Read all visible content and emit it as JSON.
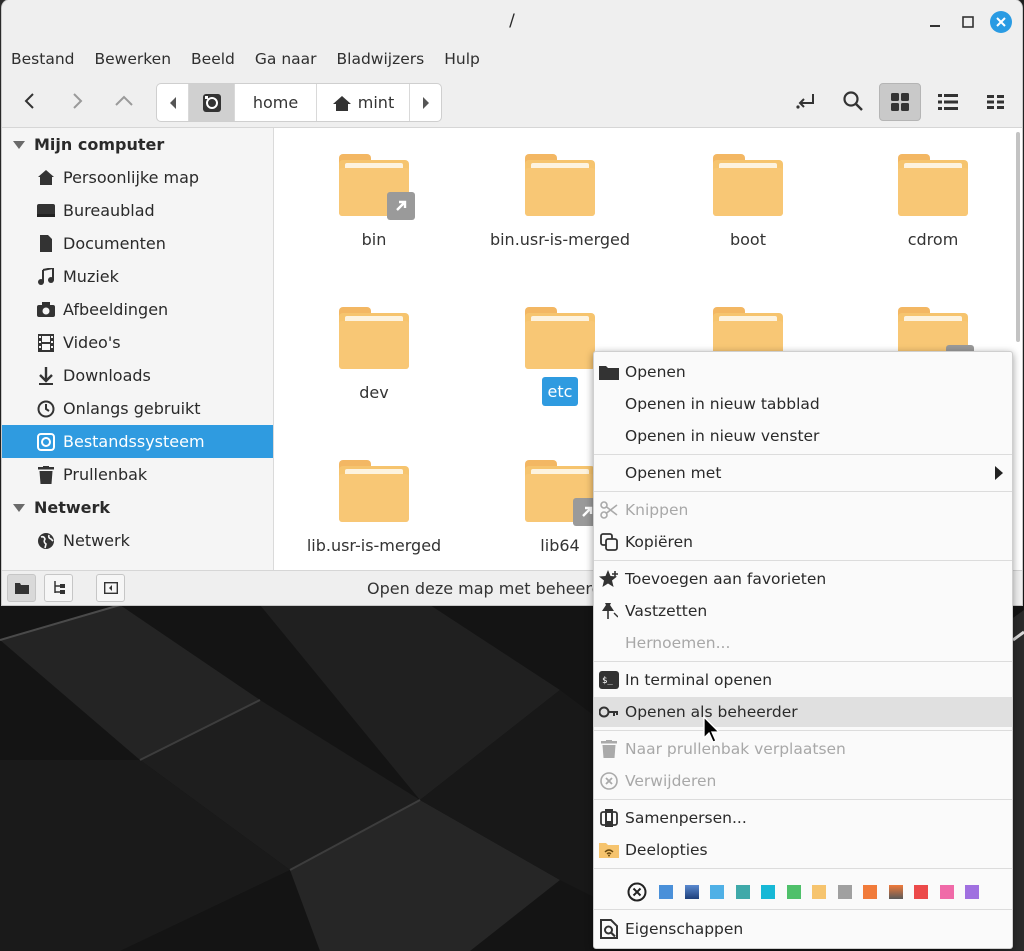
{
  "window": {
    "title": "/"
  },
  "menubar": [
    "Bestand",
    "Bewerken",
    "Beeld",
    "Ga naar",
    "Bladwijzers",
    "Hulp"
  ],
  "pathbar": {
    "segments": [
      "home",
      "mint"
    ]
  },
  "sidebar": {
    "sections": [
      {
        "title": "Mijn computer",
        "items": [
          {
            "label": "Persoonlijke map",
            "icon": "home-icon"
          },
          {
            "label": "Bureaublad",
            "icon": "desktop-icon"
          },
          {
            "label": "Documenten",
            "icon": "document-icon"
          },
          {
            "label": "Muziek",
            "icon": "music-icon"
          },
          {
            "label": "Afbeeldingen",
            "icon": "camera-icon"
          },
          {
            "label": "Video's",
            "icon": "film-icon"
          },
          {
            "label": "Downloads",
            "icon": "download-icon"
          },
          {
            "label": "Onlangs gebruikt",
            "icon": "clock-icon"
          },
          {
            "label": "Bestandssysteem",
            "icon": "drive-icon"
          },
          {
            "label": "Prullenbak",
            "icon": "trash-icon"
          }
        ]
      },
      {
        "title": "Netwerk",
        "items": [
          {
            "label": "Netwerk",
            "icon": "globe-icon"
          }
        ]
      }
    ],
    "selected": "Bestandssysteem"
  },
  "files": [
    {
      "name": "bin",
      "symlink": true
    },
    {
      "name": "bin.usr-is-merged",
      "symlink": false
    },
    {
      "name": "boot",
      "symlink": false
    },
    {
      "name": "cdrom",
      "symlink": false
    },
    {
      "name": "dev",
      "symlink": false
    },
    {
      "name": "etc",
      "symlink": false,
      "selected": true
    },
    {
      "name": "",
      "symlink": false
    },
    {
      "name": "",
      "symlink": true
    },
    {
      "name": "lib.usr-is-merged",
      "symlink": false
    },
    {
      "name": "lib64",
      "symlink": true
    }
  ],
  "status": {
    "text": "Open deze map met beheerder"
  },
  "context_menu": {
    "items": [
      {
        "label": "Openen",
        "icon": "folder-icon",
        "disabled": false
      },
      {
        "label": "Openen in nieuw tabblad",
        "icon": "",
        "disabled": false
      },
      {
        "label": "Openen in nieuw venster",
        "icon": "",
        "disabled": false
      },
      {
        "label": "Openen met",
        "icon": "",
        "disabled": false,
        "submenu": true
      },
      {
        "label": "Knippen",
        "icon": "scissors-icon",
        "disabled": true
      },
      {
        "label": "Kopiëren",
        "icon": "copy-icon",
        "disabled": false
      },
      {
        "label": "Toevoegen aan favorieten",
        "icon": "star-icon",
        "disabled": false
      },
      {
        "label": "Vastzetten",
        "icon": "pin-icon",
        "disabled": false
      },
      {
        "label": "Hernoemen...",
        "icon": "",
        "disabled": true
      },
      {
        "label": "In terminal openen",
        "icon": "terminal-icon",
        "disabled": false
      },
      {
        "label": "Openen als beheerder",
        "icon": "key-icon",
        "disabled": false,
        "hover": true
      },
      {
        "label": "Naar prullenbak verplaatsen",
        "icon": "trash-icon",
        "disabled": true
      },
      {
        "label": "Verwijderen",
        "icon": "delete-icon",
        "disabled": true
      },
      {
        "label": "Samenpersen...",
        "icon": "compress-icon",
        "disabled": false
      },
      {
        "label": "Deelopties",
        "icon": "share-folder-icon",
        "disabled": false
      },
      {
        "label": "Eigenschappen",
        "icon": "properties-icon",
        "disabled": false
      }
    ],
    "colors": [
      "#4a90d9",
      "#2e5aa8",
      "#4fb0e6",
      "#3fa9a9",
      "#17b8d6",
      "#4fc06a",
      "#f6c46e",
      "#a0a0a0",
      "#f17b3a",
      "#8a6a5a",
      "#ec4a4a",
      "#f06aa8",
      "#a070e0"
    ]
  }
}
